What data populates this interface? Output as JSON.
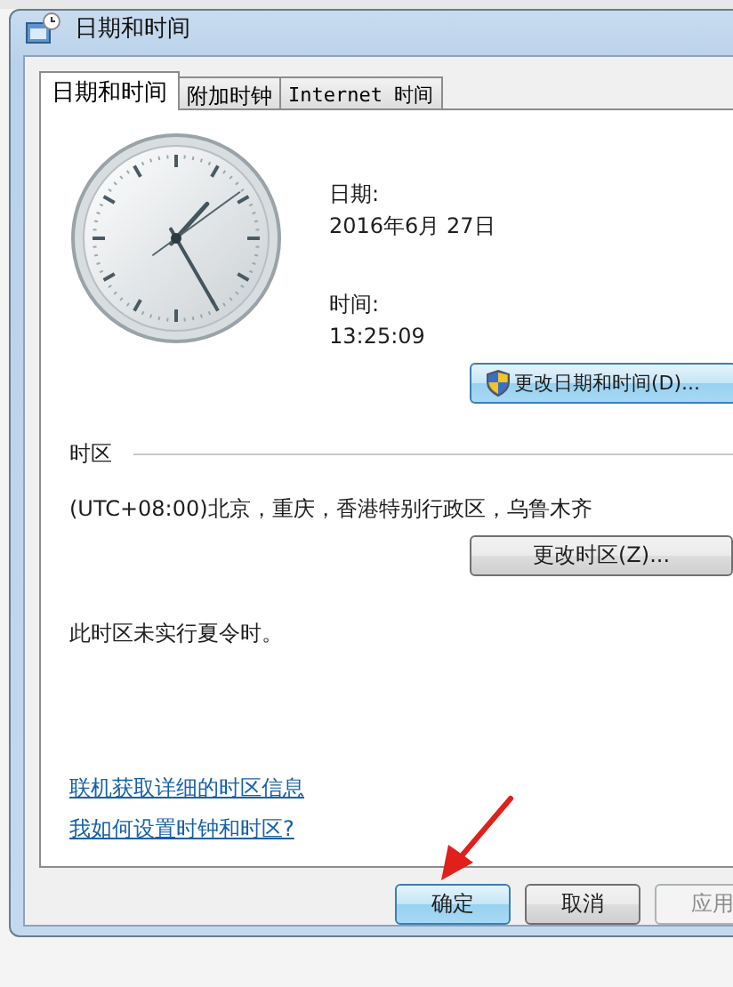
{
  "window": {
    "title": "日期和时间"
  },
  "tabs": [
    {
      "label": "日期和时间",
      "selected": true
    },
    {
      "label": "附加时钟",
      "selected": false
    },
    {
      "label": "Internet 时间",
      "selected": false
    }
  ],
  "date": {
    "label": "日期:",
    "value": "2016年6月 27日"
  },
  "time": {
    "label": "时间:",
    "value": "13:25:09"
  },
  "change_datetime_button": "更改日期和时间(D)...",
  "timezone": {
    "heading": "时区",
    "value": "(UTC+08:00)北京，重庆，香港特别行政区，乌鲁木齐",
    "button": "更改时区(Z)...",
    "dst_note": "此时区未实行夏令时。"
  },
  "links": [
    "联机获取详细的时区信息",
    "我如何设置时钟和时区?"
  ],
  "buttons": [
    {
      "label": "确定",
      "default": true,
      "disabled": false
    },
    {
      "label": "取消",
      "default": false,
      "disabled": false
    },
    {
      "label": "应用",
      "default": false,
      "disabled": true
    }
  ]
}
